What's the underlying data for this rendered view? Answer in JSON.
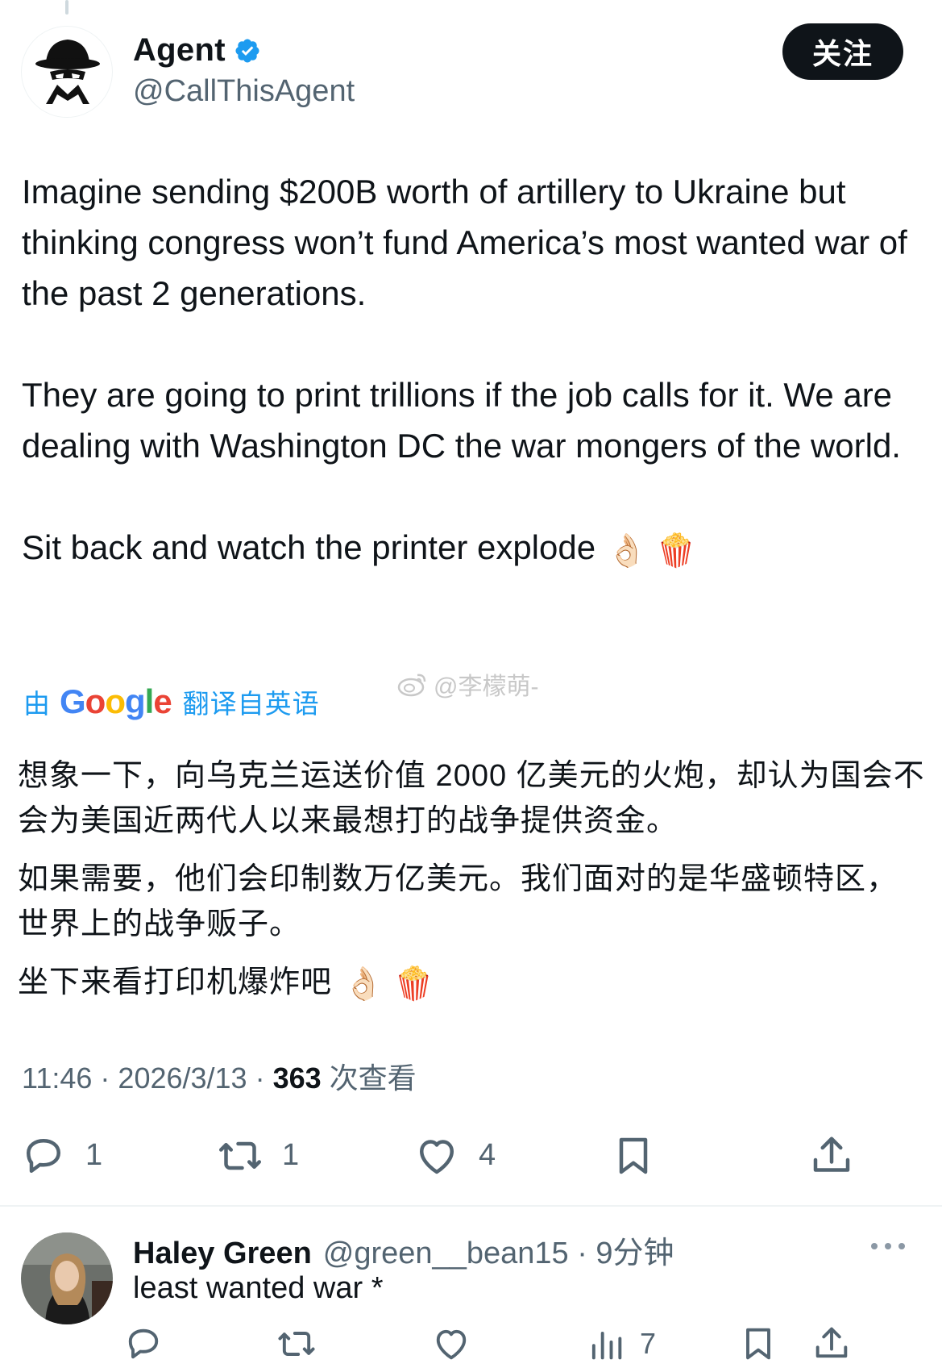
{
  "tweet": {
    "display_name": "Agent",
    "handle": "@CallThisAgent",
    "follow_label": "关注",
    "body": [
      "Imagine sending $200B worth of artillery to Ukraine but thinking congress won’t fund America’s most wanted war of the past 2 generations.",
      "They are going to print trillions if the job calls for it. We are dealing with Washington DC the war mongers of the world.",
      "Sit back and watch the printer explode"
    ],
    "body_emoji": "👌🏻 🍿",
    "translation": {
      "by_label": "由",
      "google": [
        "G",
        "o",
        "o",
        "g",
        "l",
        "e"
      ],
      "from_label": "翻译自英语",
      "paragraphs": [
        "想象一下，向乌克兰运送价值 2000 亿美元的火炮，却认为国会不会为美国近两代人以来最想打的战争提供资金。",
        "如果需要，他们会印制数万亿美元。我们面对的是华盛顿特区，世界上的战争贩子。",
        "坐下来看打印机爆炸吧"
      ],
      "emoji": "👌🏻 🍿"
    },
    "watermark": "@李檬萌-",
    "meta": {
      "time": "11:46",
      "date": "2026/3/13",
      "separator": " · ",
      "views": "363",
      "views_label": " 次查看"
    },
    "actions": {
      "reply_count": "1",
      "retweet_count": "1",
      "like_count": "4"
    }
  },
  "reply": {
    "display_name": "Haley Green",
    "handle_time": "@green__bean15 · 9分钟",
    "text": "least wanted war *",
    "views_count": "7"
  },
  "colors": {
    "accent": "#1d9bf0",
    "text": "#0f1419",
    "muted": "#536471",
    "follow_bg": "#0f1419"
  }
}
